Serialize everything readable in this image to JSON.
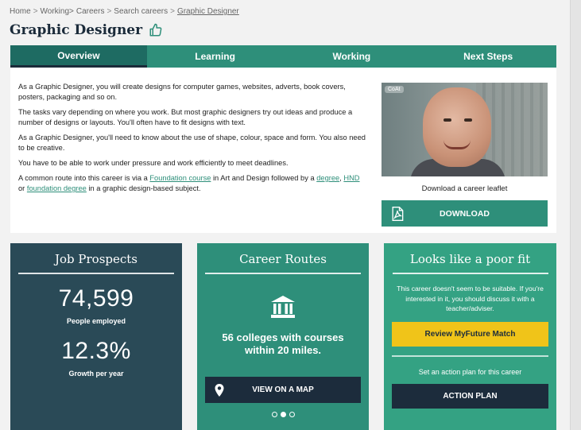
{
  "breadcrumb": [
    {
      "label": "Home",
      "link": false
    },
    {
      "label": "Working>",
      "link": false
    },
    {
      "label": "Careers",
      "link": false
    },
    {
      "label": "Search careers",
      "link": false
    },
    {
      "label": "Graphic Designer",
      "link": true
    }
  ],
  "breadcrumb_sep": ">",
  "page_title": "Graphic Designer",
  "tabs": [
    {
      "label": "Overview",
      "active": true
    },
    {
      "label": "Learning",
      "active": false
    },
    {
      "label": "Working",
      "active": false
    },
    {
      "label": "Next Steps",
      "active": false
    }
  ],
  "overview": {
    "p1": "As a Graphic Designer, you will create designs for computer games, websites, adverts, book covers, posters, packaging and so on.",
    "p2": "The tasks vary depending on where you work. But most graphic designers try out ideas and produce a number of designs or layouts. You'll often have to fit designs with text.",
    "p3": "As a Graphic Designer, you'll need to know about the use of shape, colour, space and form. You also need to be creative.",
    "p4": "You have to be able to work under pressure and work efficiently to meet deadlines.",
    "p5_a": "A common route into this career is via a",
    "p5_link1": "Foundation course",
    "p5_b": "in Art and Design followed by a",
    "p5_link2": "degree",
    "p5_c": ",",
    "p5_link3": "HND",
    "p5_d": "or",
    "p5_link4": "foundation degree",
    "p5_e": "in a graphic design-based subject.",
    "video_badge": "CoAt",
    "leaflet_label": "Download a career leaflet",
    "download_label": "DOWNLOAD"
  },
  "job_prospects": {
    "title": "Job Prospects",
    "employed_value": "74,599",
    "employed_label": "People employed",
    "growth_value": "12.3%",
    "growth_label": "Growth per year"
  },
  "career_routes": {
    "title": "Career Routes",
    "text": "56 colleges with courses within 20 miles.",
    "map_button": "VIEW ON A MAP",
    "carousel_active_index": 1,
    "carousel_count": 3
  },
  "poor_fit": {
    "title": "Looks like a poor fit",
    "text": "This career doesn't seem to be suitable. If you're interested in it, you should discuss it with a teacher/adviser.",
    "review_button": "Review MyFuture Match",
    "action_label": "Set an action plan for this career",
    "action_button": "ACTION PLAN"
  },
  "colors": {
    "teal": "#2e8f7a",
    "dark_teal": "#1e6b62",
    "navy": "#1c2c3c",
    "slate": "#2a4a57",
    "green": "#34a283",
    "yellow": "#f0c419"
  },
  "icons": {
    "thumb": "thumbs-up-icon",
    "pdf": "pdf-icon",
    "bank": "institution-icon",
    "pin": "location-pin-icon"
  }
}
